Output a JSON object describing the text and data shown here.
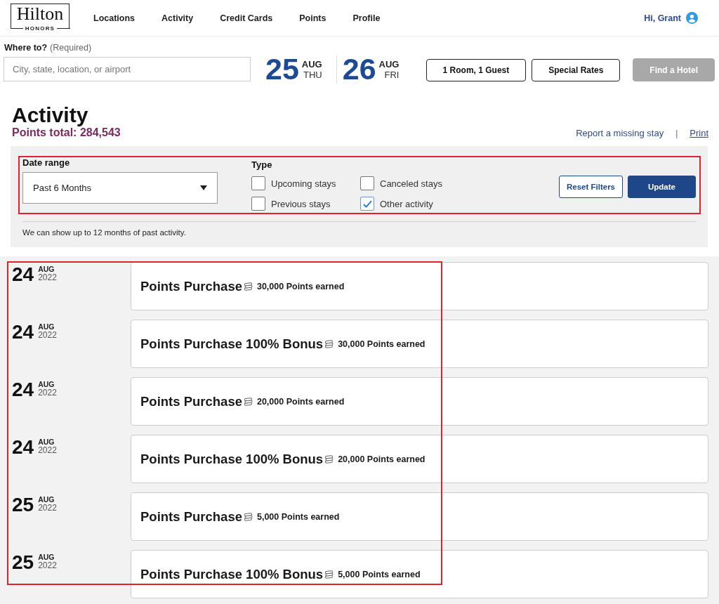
{
  "header": {
    "logo": {
      "wordmark": "Hilton",
      "subtitle": "HONORS"
    },
    "nav": [
      "Locations",
      "Activity",
      "Credit Cards",
      "Points",
      "Profile"
    ],
    "greeting": "Hi, Grant"
  },
  "search": {
    "label": "Where to?",
    "hint": "(Required)",
    "placeholder": "City, state, location, or airport",
    "dates": [
      {
        "day": "25",
        "month": "AUG",
        "weekday": "THU"
      },
      {
        "day": "26",
        "month": "AUG",
        "weekday": "FRI"
      }
    ],
    "buttons": [
      {
        "label": "1 Room, 1 Guest",
        "disabled": false
      },
      {
        "label": "Special Rates",
        "disabled": false
      },
      {
        "label": "Find a Hotel",
        "disabled": true
      }
    ]
  },
  "activity_header": {
    "title": "Activity",
    "points_total": "Points total: 284,543",
    "links": [
      {
        "label": "Report a missing stay",
        "underlined": false
      },
      {
        "label": "Print",
        "underlined": true
      }
    ],
    "separator": "|"
  },
  "filters": {
    "highlighted": true,
    "date_range": {
      "label": "Date range",
      "value": "Past 6 Months"
    },
    "type": {
      "label": "Type",
      "options": [
        {
          "label": "Upcoming stays",
          "checked": false
        },
        {
          "label": "Canceled stays",
          "checked": false
        },
        {
          "label": "Previous stays",
          "checked": false
        },
        {
          "label": "Other activity",
          "checked": true
        }
      ]
    },
    "buttons": [
      {
        "label": "Reset Filters",
        "kind": "secondary"
      },
      {
        "label": "Update",
        "kind": "primary"
      }
    ],
    "note": "We can show up to 12 months of past activity."
  },
  "activity": {
    "highlighted": true,
    "entries": [
      {
        "day": "24",
        "month": "AUG",
        "year": "2022",
        "title": "Points Purchase",
        "points": "30,000 Points earned"
      },
      {
        "day": "24",
        "month": "AUG",
        "year": "2022",
        "title": "Points Purchase 100% Bonus",
        "points": "30,000 Points earned"
      },
      {
        "day": "24",
        "month": "AUG",
        "year": "2022",
        "title": "Points Purchase",
        "points": "20,000 Points earned"
      },
      {
        "day": "24",
        "month": "AUG",
        "year": "2022",
        "title": "Points Purchase 100% Bonus",
        "points": "20,000 Points earned"
      },
      {
        "day": "25",
        "month": "AUG",
        "year": "2022",
        "title": "Points Purchase",
        "points": "5,000 Points earned"
      },
      {
        "day": "25",
        "month": "AUG",
        "year": "2022",
        "title": "Points Purchase 100% Bonus",
        "points": "5,000 Points earned"
      }
    ]
  }
}
